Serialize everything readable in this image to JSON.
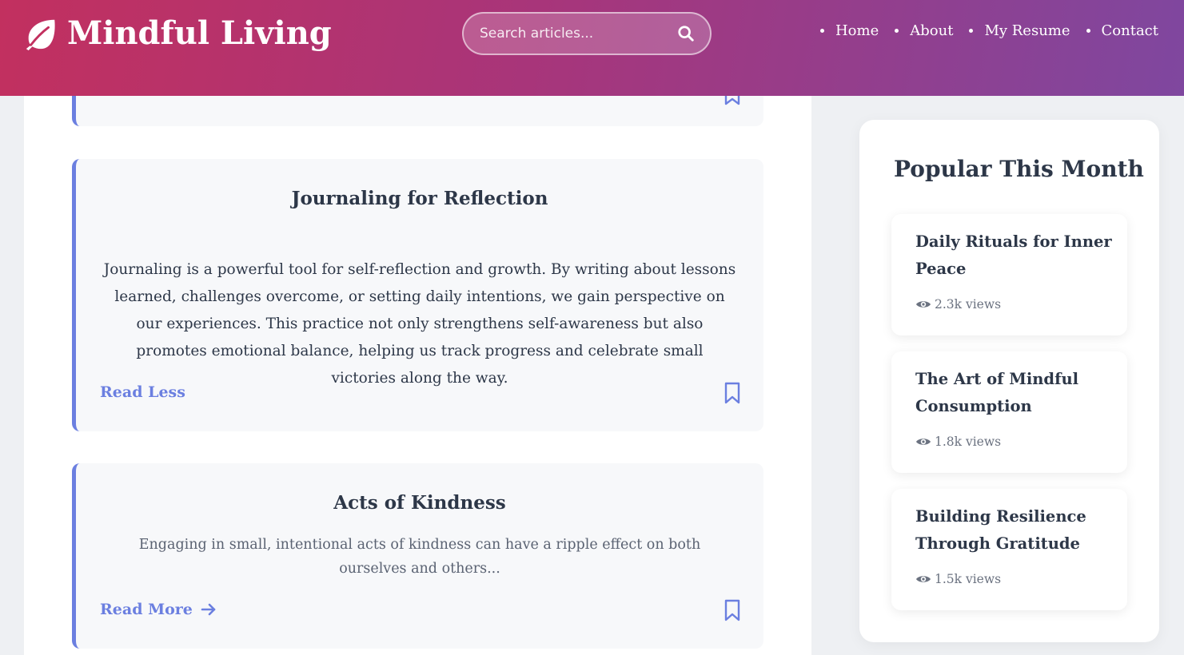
{
  "header": {
    "brand": "Mindful Living",
    "search_placeholder": "Search articles...",
    "nav": [
      "Home",
      "About",
      "My Resume",
      "Contact"
    ],
    "gradient_start": "#c2305f",
    "gradient_end": "#7f479f"
  },
  "articles": [
    {
      "title": "Journaling for Reflection",
      "body": "Journaling is a powerful tool for self-reflection and growth. By writing about lessons learned, challenges overcome, or setting daily intentions, we gain perspective on our experiences. This practice not only strengthens self-awareness but also promotes emotional balance, helping us track progress and celebrate small victories along the way.",
      "link": "Read Less"
    },
    {
      "title": "Acts of Kindness",
      "body": "Engaging in small, intentional acts of kindness can have a ripple effect on both ourselves and others...",
      "link": "Read More"
    }
  ],
  "sidebar": {
    "title": "Popular This Month",
    "items": [
      {
        "title": "Daily Rituals for Inner Peace",
        "views": "2.3k views"
      },
      {
        "title": "The Art of Mindful Consumption",
        "views": "1.8k views"
      },
      {
        "title": "Building Resilience Through Gratitude",
        "views": "1.5k views"
      }
    ]
  },
  "colors": {
    "accent": "#6b7fe0",
    "text": "#2d3748",
    "card_bg": "#f7f8fa"
  },
  "icons": [
    "leaf-icon",
    "search-icon",
    "bookmark-icon",
    "arrow-right-icon",
    "eye-icon"
  ]
}
